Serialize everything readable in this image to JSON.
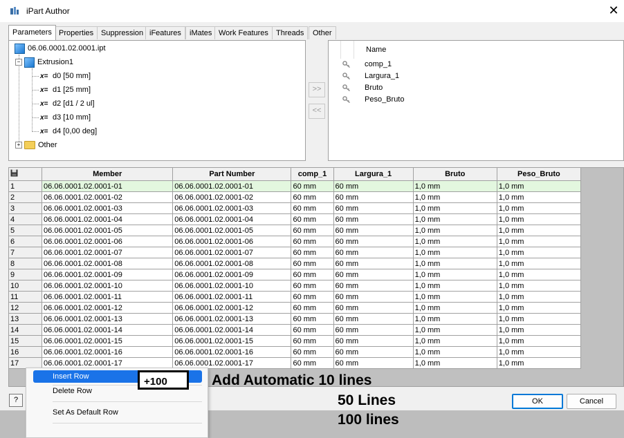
{
  "window": {
    "title": "iPart Author",
    "close_glyph": "✕"
  },
  "tabs": [
    "Parameters",
    "Properties",
    "Suppression",
    "iFeatures",
    "iMates",
    "Work Features",
    "Threads",
    "Other"
  ],
  "tree": {
    "root": "06.06.0001.02.0001.ipt",
    "extrusion": "Extrusion1",
    "params": [
      "d0 [50 mm]",
      "d1 [25 mm]",
      "d2 [d1 / 2 ul]",
      "d3 [10 mm]",
      "d4 [0,00 deg]"
    ],
    "param_prefix": "x=",
    "other": "Other"
  },
  "transfer": {
    "add": ">>",
    "remove": "<<"
  },
  "selected_params": {
    "header": "Name",
    "items": [
      "comp_1",
      "Largura_1",
      "Bruto",
      "Peso_Bruto"
    ]
  },
  "table": {
    "columns": [
      "Member",
      "Part Number",
      "comp_1",
      "Largura_1",
      "Bruto",
      "Peso_Bruto"
    ],
    "rows": [
      [
        "1",
        "06.06.0001.02.0001-01",
        "06.06.0001.02.0001-01",
        "60 mm",
        "60 mm",
        "1,0 mm",
        "1,0 mm"
      ],
      [
        "2",
        "06.06.0001.02.0001-02",
        "06.06.0001.02.0001-02",
        "60 mm",
        "60 mm",
        "1,0 mm",
        "1,0 mm"
      ],
      [
        "3",
        "06.06.0001.02.0001-03",
        "06.06.0001.02.0001-03",
        "60 mm",
        "60 mm",
        "1,0 mm",
        "1,0 mm"
      ],
      [
        "4",
        "06.06.0001.02.0001-04",
        "06.06.0001.02.0001-04",
        "60 mm",
        "60 mm",
        "1,0 mm",
        "1,0 mm"
      ],
      [
        "5",
        "06.06.0001.02.0001-05",
        "06.06.0001.02.0001-05",
        "60 mm",
        "60 mm",
        "1,0 mm",
        "1,0 mm"
      ],
      [
        "6",
        "06.06.0001.02.0001-06",
        "06.06.0001.02.0001-06",
        "60 mm",
        "60 mm",
        "1,0 mm",
        "1,0 mm"
      ],
      [
        "7",
        "06.06.0001.02.0001-07",
        "06.06.0001.02.0001-07",
        "60 mm",
        "60 mm",
        "1,0 mm",
        "1,0 mm"
      ],
      [
        "8",
        "06.06.0001.02.0001-08",
        "06.06.0001.02.0001-08",
        "60 mm",
        "60 mm",
        "1,0 mm",
        "1,0 mm"
      ],
      [
        "9",
        "06.06.0001.02.0001-09",
        "06.06.0001.02.0001-09",
        "60 mm",
        "60 mm",
        "1,0 mm",
        "1,0 mm"
      ],
      [
        "10",
        "06.06.0001.02.0001-10",
        "06.06.0001.02.0001-10",
        "60 mm",
        "60 mm",
        "1,0 mm",
        "1,0 mm"
      ],
      [
        "11",
        "06.06.0001.02.0001-11",
        "06.06.0001.02.0001-11",
        "60 mm",
        "60 mm",
        "1,0 mm",
        "1,0 mm"
      ],
      [
        "12",
        "06.06.0001.02.0001-12",
        "06.06.0001.02.0001-12",
        "60 mm",
        "60 mm",
        "1,0 mm",
        "1,0 mm"
      ],
      [
        "13",
        "06.06.0001.02.0001-13",
        "06.06.0001.02.0001-13",
        "60 mm",
        "60 mm",
        "1,0 mm",
        "1,0 mm"
      ],
      [
        "14",
        "06.06.0001.02.0001-14",
        "06.06.0001.02.0001-14",
        "60 mm",
        "60 mm",
        "1,0 mm",
        "1,0 mm"
      ],
      [
        "15",
        "06.06.0001.02.0001-15",
        "06.06.0001.02.0001-15",
        "60 mm",
        "60 mm",
        "1,0 mm",
        "1,0 mm"
      ],
      [
        "16",
        "06.06.0001.02.0001-16",
        "06.06.0001.02.0001-16",
        "60 mm",
        "60 mm",
        "1,0 mm",
        "1,0 mm"
      ],
      [
        "17",
        "06.06.0001.02.0001-17",
        "06.06.0001.02.0001-17",
        "60 mm",
        "60 mm",
        "1,0 mm",
        "1,0 mm"
      ]
    ]
  },
  "context_menu": [
    "Insert Row",
    "Delete Row",
    "Set As Default Row"
  ],
  "buttons": {
    "ok": "OK",
    "cancel": "Cancel",
    "help": "?"
  },
  "annotations": {
    "box": "+100",
    "line1": "Add Automatic 10 lines",
    "line2": "50 Lines",
    "line3": "100 lines"
  }
}
